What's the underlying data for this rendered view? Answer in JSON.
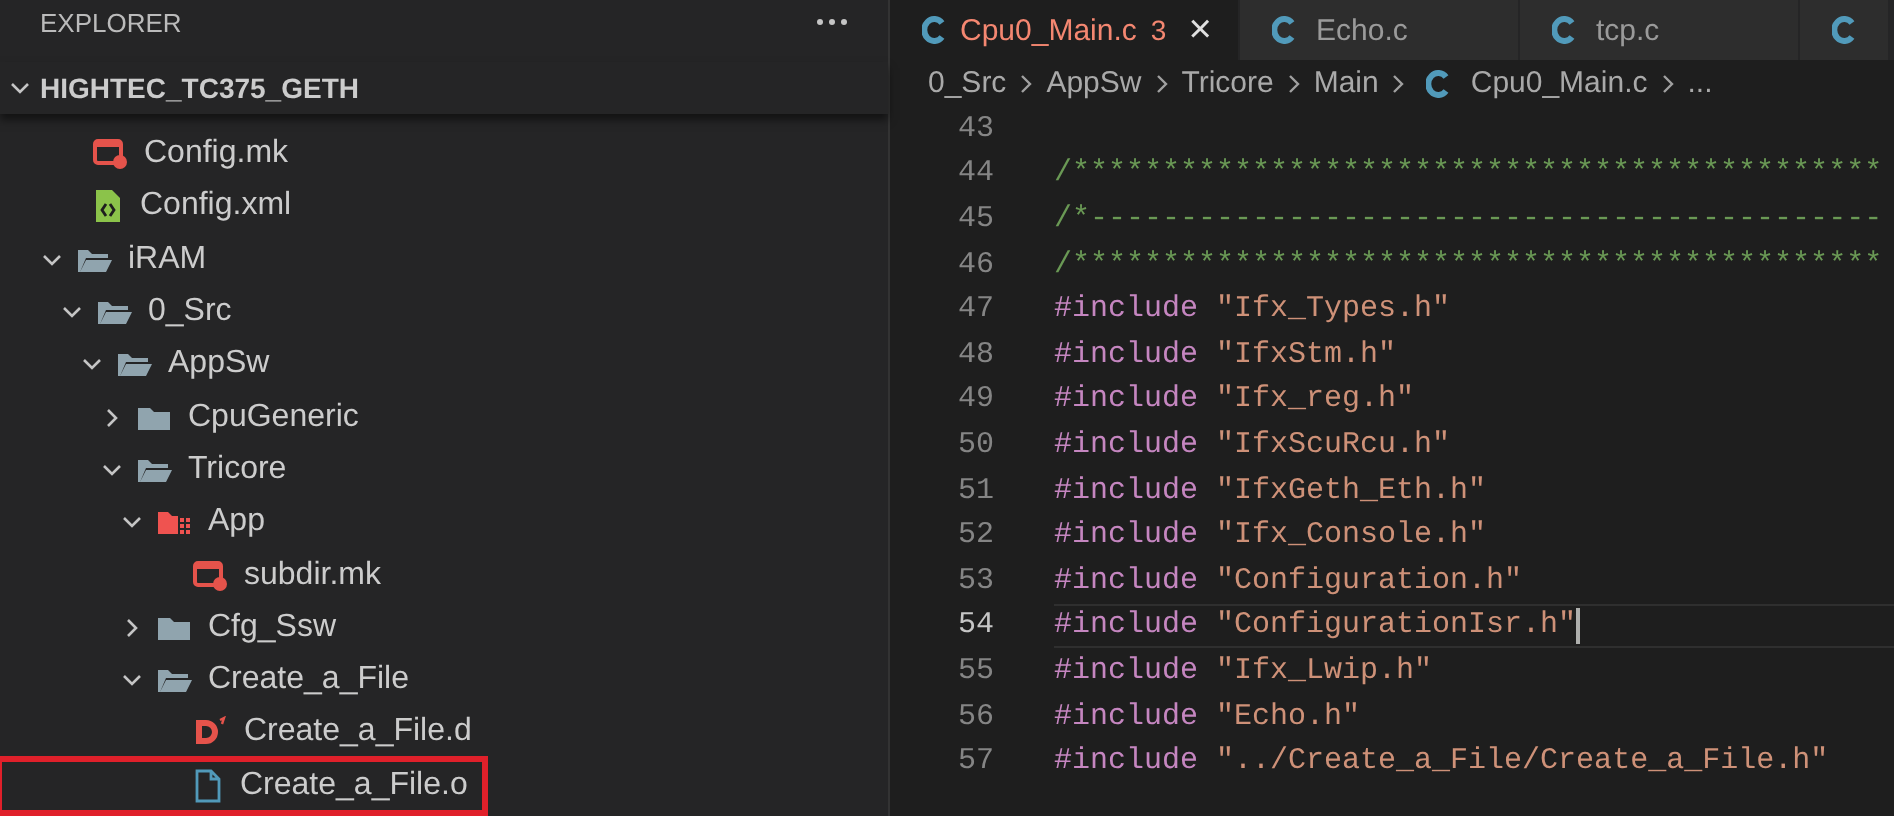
{
  "explorer": {
    "title": "EXPLORER",
    "project": {
      "name": "HIGHTEC_TC375_GETH",
      "expanded": true
    },
    "tree": [
      {
        "name": "Config.mk",
        "kind": "makefile",
        "highlighted": false
      },
      {
        "name": "Config.xml",
        "kind": "xml",
        "highlighted": false
      },
      {
        "name": "iRAM",
        "kind": "folder",
        "expanded": true,
        "children": [
          {
            "name": "0_Src",
            "kind": "folder",
            "expanded": true,
            "children": [
              {
                "name": "AppSw",
                "kind": "folder",
                "expanded": true,
                "children": [
                  {
                    "name": "CpuGeneric",
                    "kind": "folder",
                    "expanded": false
                  },
                  {
                    "name": "Tricore",
                    "kind": "folder",
                    "expanded": true,
                    "children": [
                      {
                        "name": "App",
                        "kind": "app-folder",
                        "expanded": true,
                        "children": [
                          {
                            "name": "subdir.mk",
                            "kind": "makefile",
                            "highlighted": false
                          }
                        ]
                      },
                      {
                        "name": "Cfg_Ssw",
                        "kind": "folder",
                        "expanded": false
                      },
                      {
                        "name": "Create_a_File",
                        "kind": "folder",
                        "expanded": true,
                        "children": [
                          {
                            "name": "Create_a_File.d",
                            "kind": "dep-file",
                            "highlighted": false
                          },
                          {
                            "name": "Create_a_File.o",
                            "kind": "object-file",
                            "highlighted": true
                          }
                        ]
                      }
                    ]
                  }
                ]
              }
            ]
          }
        ]
      }
    ]
  },
  "tabs": [
    {
      "label": "Cpu0_Main.c",
      "selected": true,
      "problems": "3",
      "close": "×"
    },
    {
      "label": "Echo.c",
      "selected": false
    },
    {
      "label": "tcp.c",
      "selected": false
    },
    {
      "selected": false
    }
  ],
  "breadcrumb": [
    {
      "text": "0_Src",
      "kind": "folder"
    },
    {
      "text": "AppSw",
      "kind": "folder"
    },
    {
      "text": "Tricore",
      "kind": "folder"
    },
    {
      "text": "Main",
      "kind": "folder"
    },
    {
      "text": "Cpu0_Main.c",
      "kind": "c-file"
    },
    {
      "text": "...",
      "kind": "symbol"
    }
  ],
  "code": [
    {
      "number": "43",
      "current": false
    },
    {
      "number": "44",
      "current": false,
      "tokens": [
        {
          "kind": "comment",
          "text": "/*********************************************"
        }
      ]
    },
    {
      "number": "45",
      "current": false,
      "tokens": [
        {
          "kind": "comment",
          "text": "/*--------------------------------------------"
        }
      ]
    },
    {
      "number": "46",
      "current": false,
      "tokens": [
        {
          "kind": "comment",
          "text": "/*********************************************"
        }
      ]
    },
    {
      "number": "47",
      "current": false,
      "tokens": [
        {
          "kind": "directive",
          "text": "#include"
        },
        {
          "kind": "string",
          "text": "\"Ifx_Types.h\""
        }
      ]
    },
    {
      "number": "48",
      "current": false,
      "tokens": [
        {
          "kind": "directive",
          "text": "#include"
        },
        {
          "kind": "string",
          "text": "\"IfxStm.h\""
        }
      ]
    },
    {
      "number": "49",
      "current": false,
      "tokens": [
        {
          "kind": "directive",
          "text": "#include"
        },
        {
          "kind": "string",
          "text": "\"Ifx_reg.h\""
        }
      ]
    },
    {
      "number": "50",
      "current": false,
      "tokens": [
        {
          "kind": "directive",
          "text": "#include"
        },
        {
          "kind": "string",
          "text": "\"IfxScuRcu.h\""
        }
      ]
    },
    {
      "number": "51",
      "current": false,
      "tokens": [
        {
          "kind": "directive",
          "text": "#include"
        },
        {
          "kind": "string",
          "text": "\"IfxGeth_Eth.h\""
        }
      ]
    },
    {
      "number": "52",
      "current": false,
      "tokens": [
        {
          "kind": "directive",
          "text": "#include"
        },
        {
          "kind": "string",
          "text": "\"Ifx_Console.h\""
        }
      ]
    },
    {
      "number": "53",
      "current": false,
      "tokens": [
        {
          "kind": "directive",
          "text": "#include"
        },
        {
          "kind": "string",
          "text": "\"Configuration.h\""
        }
      ]
    },
    {
      "number": "54",
      "current": true,
      "tokens": [
        {
          "kind": "directive",
          "text": "#include"
        },
        {
          "kind": "string",
          "text": "\"ConfigurationIsr.h\""
        }
      ]
    },
    {
      "number": "55",
      "current": false,
      "tokens": [
        {
          "kind": "directive",
          "text": "#include"
        },
        {
          "kind": "string",
          "text": "\"Ifx_Lwip.h\""
        }
      ]
    },
    {
      "number": "56",
      "current": false,
      "tokens": [
        {
          "kind": "directive",
          "text": "#include"
        },
        {
          "kind": "string",
          "text": "\"Echo.h\""
        }
      ]
    },
    {
      "number": "57",
      "current": false,
      "tokens": [
        {
          "kind": "directive",
          "text": "#include"
        },
        {
          "kind": "string",
          "text": "\"../Create_a_File/Create_a_File.h\""
        }
      ]
    }
  ]
}
